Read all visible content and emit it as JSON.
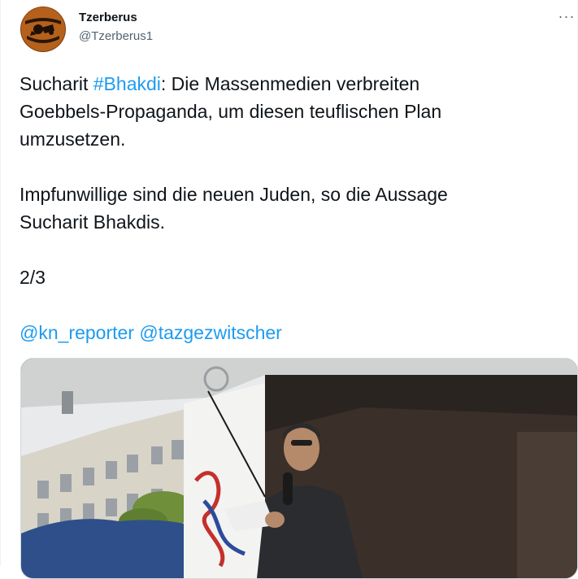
{
  "author": {
    "name": "Tzerberus",
    "handle": "@Tzerberus1",
    "avatar_icon": "greek-vase-avatar-icon"
  },
  "menu": {
    "label": "···"
  },
  "tweet": {
    "line1_prefix": "Sucharit ",
    "hashtag": "#Bhakdi",
    "line1_rest": ": Die Massenmedien verbreiten",
    "line2": "Goebbels-Propaganda, um diesen teuflischen Plan",
    "line3": "umzusetzen.",
    "line4": "Impfunwillige sind die neuen Juden, so die Aussage",
    "line5": "Sucharit Bhakdis.",
    "counter": "2/3",
    "mention1": "@kn_reporter",
    "mention2": "@tazgezwitscher"
  },
  "colors": {
    "link": "#1d9bf0",
    "text": "#0f1419",
    "secondary": "#536471"
  },
  "media": {
    "type": "video-thumbnail"
  }
}
